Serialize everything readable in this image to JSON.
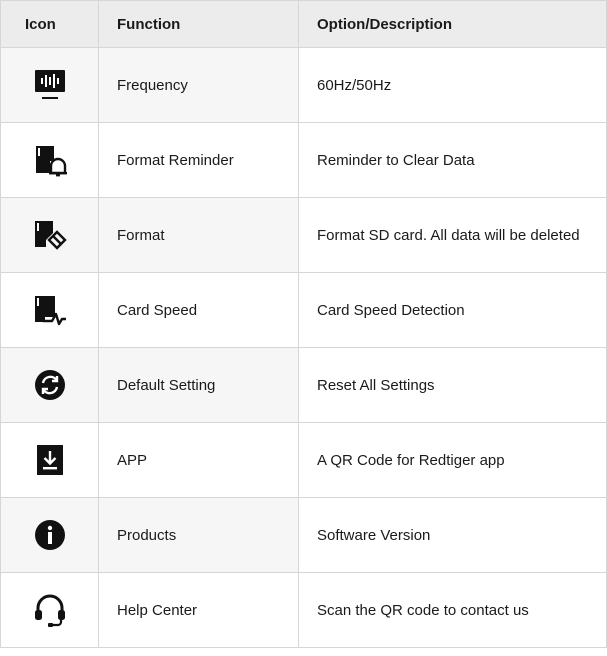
{
  "table": {
    "headers": {
      "icon": "Icon",
      "function": "Function",
      "option": "Option/Description"
    },
    "rows": [
      {
        "icon": "frequency-icon",
        "function": "Frequency",
        "option": "60Hz/50Hz"
      },
      {
        "icon": "format-reminder-icon",
        "function": "Format Reminder",
        "option": "Reminder to Clear Data"
      },
      {
        "icon": "format-icon",
        "function": "Format",
        "option": "Format SD card. All data will be deleted"
      },
      {
        "icon": "card-speed-icon",
        "function": "Card Speed",
        "option": "Card Speed Detection"
      },
      {
        "icon": "default-setting-icon",
        "function": "Default Setting",
        "option": "Reset All Settings"
      },
      {
        "icon": "app-download-icon",
        "function": "APP",
        "option": "A QR Code for Redtiger app"
      },
      {
        "icon": "info-icon",
        "function": "Products",
        "option": "Software Version"
      },
      {
        "icon": "headset-icon",
        "function": "Help Center",
        "option": "Scan the QR code to contact us"
      }
    ]
  }
}
